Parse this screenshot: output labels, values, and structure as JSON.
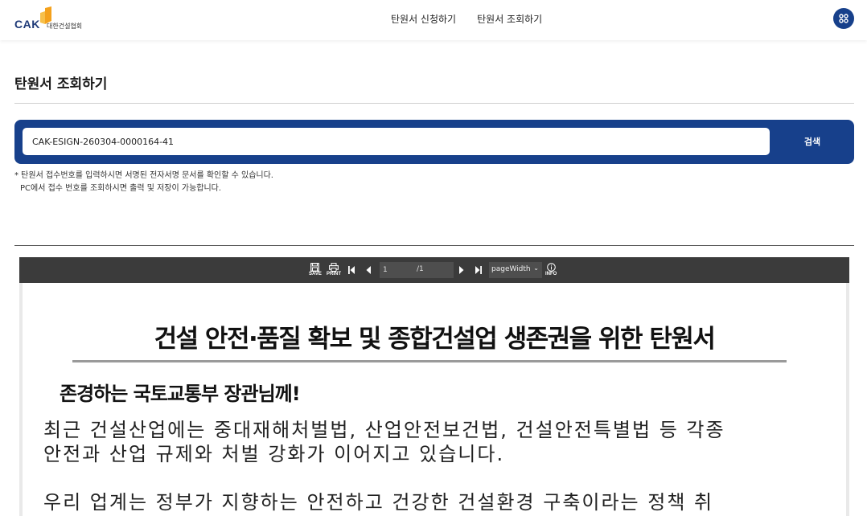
{
  "header": {
    "logo_text": "CAK",
    "logo_subtext": "대한건설협회",
    "nav": [
      {
        "label": "탄원서 신청하기"
      },
      {
        "label": "탄원서 조회하기"
      }
    ]
  },
  "page": {
    "title": "탄원서 조회하기"
  },
  "search": {
    "value": "CAK-ESIGN-260304-0000164-41",
    "button_label": "검색"
  },
  "notice": {
    "line1": "* 탄원서 접수번호를 입력하시면 서명된 전자서명 문서를 확인할 수 있습니다.",
    "line2": "PC에서 접수 번호를 조회하시면 출력 및 저장이 가능합니다."
  },
  "viewer": {
    "toolbar": {
      "save_label": "SAVE",
      "print_label": "PRINT",
      "info_label": "INFO",
      "page_current": "1",
      "page_total": "/1",
      "zoom": "pageWidth"
    },
    "document": {
      "title": "건설 안전·품질 확보 및 종합건설업 생존권을 위한 탄원서",
      "salutation": "존경하는 국토교통부 장관님께!",
      "paragraph1_line1": "  최근 건설산업에는 중대재해처벌법, 산업안전보건법, 건설안전특별법 등 각종",
      "paragraph1_line2": "안전과 산업 규제와 처벌 강화가 이어지고 있습니다.",
      "paragraph2_line1": "  우리 업계는 정부가 지향하는 안전하고 건강한 건설환경 구축이라는 정책 취"
    }
  },
  "colors": {
    "primary": "#17408b",
    "logo_accent": "#f4a11c",
    "toolbar_bg": "#3b3b3b"
  },
  "icons": {
    "logo": "cak-logo-mark",
    "apps": "apps-grid-icon"
  }
}
